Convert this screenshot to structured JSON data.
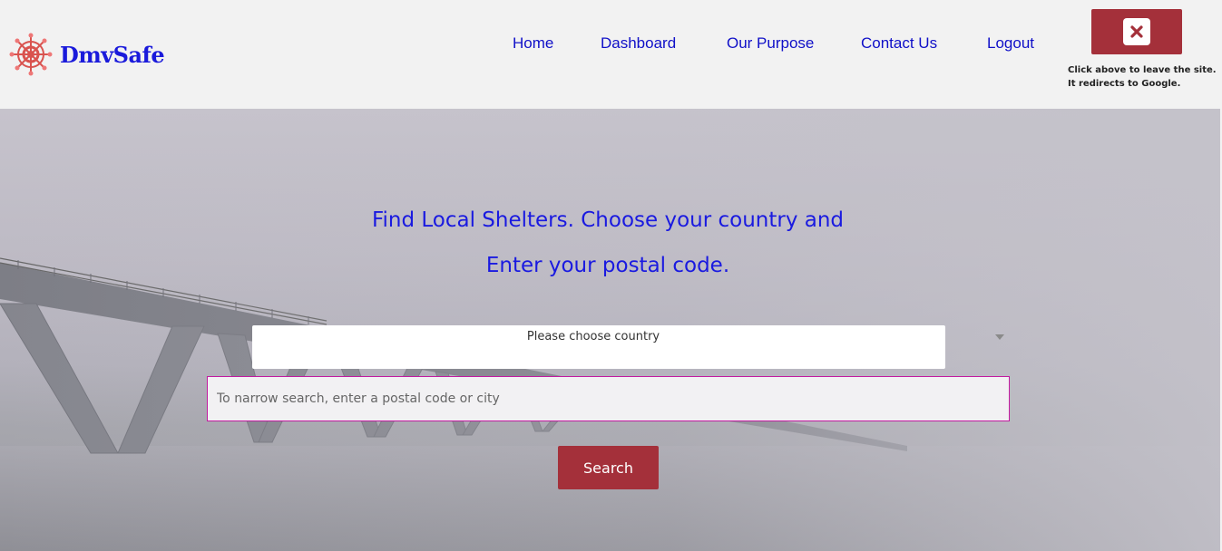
{
  "brand": {
    "name": "DmvSafe",
    "logo_icon": "ship-wheel-icon",
    "accent": "#a4303a",
    "link_color": "#1010c8"
  },
  "nav": {
    "items": [
      {
        "label": "Home"
      },
      {
        "label": "Dashboard"
      },
      {
        "label": "Our Purpose"
      },
      {
        "label": "Contact Us"
      },
      {
        "label": "Logout"
      }
    ]
  },
  "exit": {
    "icon": "close-icon",
    "note_line1": "Click above to leave the site.",
    "note_line2": "It redirects to Google."
  },
  "hero": {
    "headline_line1": "Find Local Shelters. Choose your country and",
    "headline_line2": "Enter your postal code.",
    "country_select": {
      "selected": "Please choose country"
    },
    "postal_input": {
      "placeholder": "To narrow search, enter a postal code or city",
      "value": ""
    },
    "search_label": "Search"
  }
}
